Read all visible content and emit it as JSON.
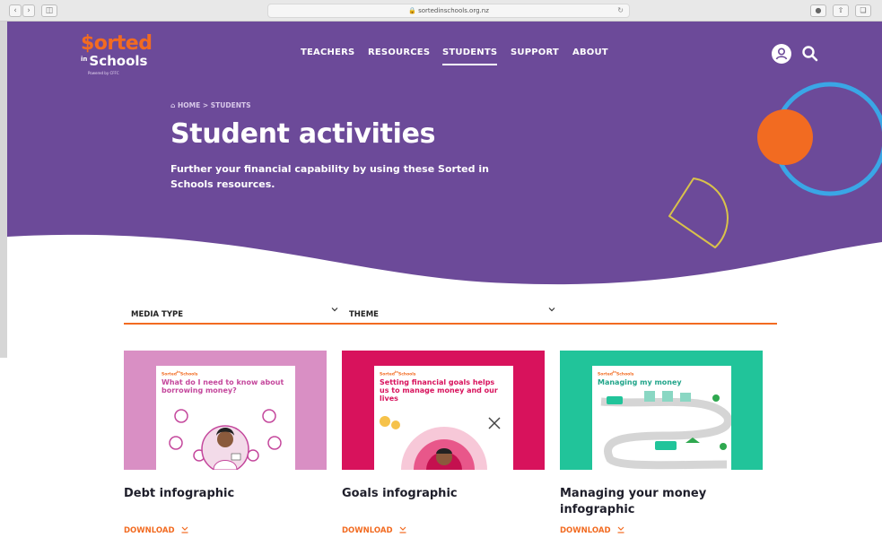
{
  "browser": {
    "url": "sortedinschools.org.nz",
    "back_icon": "chevron-left-icon",
    "forward_icon": "chevron-right-icon"
  },
  "brand": {
    "name_top": "$orted",
    "name_in": "in",
    "name_bottom": "Schools",
    "powered": "Powered by CFFC"
  },
  "nav": {
    "items": [
      {
        "label": "TEACHERS"
      },
      {
        "label": "RESOURCES"
      },
      {
        "label": "STUDENTS",
        "active": true
      },
      {
        "label": "SUPPORT"
      },
      {
        "label": "ABOUT"
      }
    ]
  },
  "breadcrumb": "HOME > STUDENTS",
  "page": {
    "title": "Student activities",
    "subtitle": "Further your financial capability by using these Sorted in Schools resources."
  },
  "filters": {
    "media_type": "MEDIA TYPE",
    "theme": "THEME"
  },
  "cards": [
    {
      "title": "Debt infographic",
      "download": "DOWNLOAD",
      "poster_heading": "What do I need to know about borrowing money?",
      "bg": "#d98fc4"
    },
    {
      "title": "Goals infographic",
      "download": "DOWNLOAD",
      "poster_heading": "Setting financial goals helps us to manage money and our lives",
      "bg": "#d8125c"
    },
    {
      "title": "Managing your money infographic",
      "download": "DOWNLOAD",
      "poster_heading": "Managing my money",
      "bg": "#21c49a"
    }
  ],
  "colors": {
    "purple": "#6c4a99",
    "orange": "#f26b21",
    "blue_ring": "#3aa6e6",
    "yellow_outline": "#d9c24a"
  }
}
